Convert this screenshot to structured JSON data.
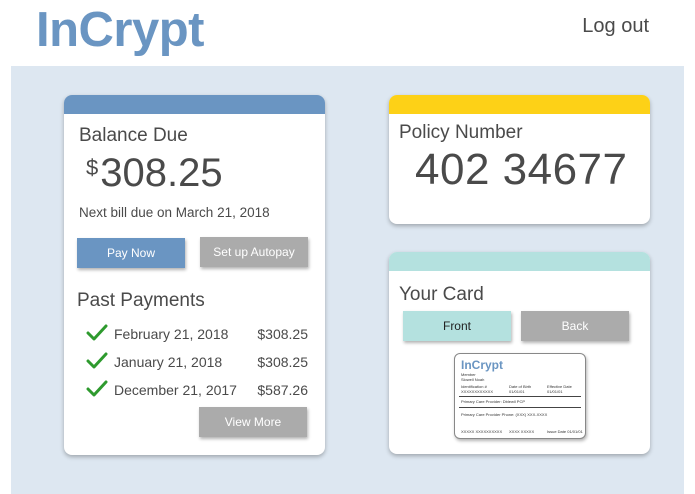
{
  "header": {
    "logo": "InCrypt",
    "logout_label": "Log out"
  },
  "balance": {
    "title": "Balance Due",
    "currency": "$",
    "amount": "308.25",
    "next_bill": "Next bill due on March 21, 2018",
    "pay_now_label": "Pay Now",
    "autopay_label": "Set up Autopay"
  },
  "past_payments": {
    "title": "Past Payments",
    "items": [
      {
        "date": "February 21, 2018",
        "amount": "$308.25"
      },
      {
        "date": "January 21, 2018",
        "amount": "$308.25"
      },
      {
        "date": "December 21, 2017",
        "amount": "$587.26"
      }
    ],
    "view_more_label": "View More"
  },
  "policy": {
    "title": "Policy Number",
    "number": "402 34677"
  },
  "your_card": {
    "title": "Your Card",
    "front_label": "Front",
    "back_label": "Back",
    "id_card": {
      "logo": "InCrypt",
      "member_label": "Member",
      "member_name": "Slowell Noah",
      "id_label": "Identification #",
      "id_value": "XXXXXXXXXXXX",
      "dob_label": "Date of Birth",
      "dob_value": "01/01/01",
      "eff_label": "Effective Date",
      "eff_value": "01/01/01",
      "pcp": "Primary Care Provider: Dblewll PCP",
      "pcp_phone": "Primary Care Provider Phone: (XXX) XXX-XXXX",
      "bottom_left": "XXXXX XXXXXXXXXX",
      "bottom_mid": "XXXX XXXXX",
      "bottom_right": "Issue Date 01/01/01"
    }
  },
  "colors": {
    "brand_blue": "#6a95c2",
    "policy_yellow": "#fdd117",
    "card_teal": "#b4e1df",
    "button_gray": "#ababab",
    "check_green": "#2e9a2e",
    "panel_bg": "#dde7f1"
  },
  "icons": {
    "payment_status": "checkmark-icon"
  }
}
